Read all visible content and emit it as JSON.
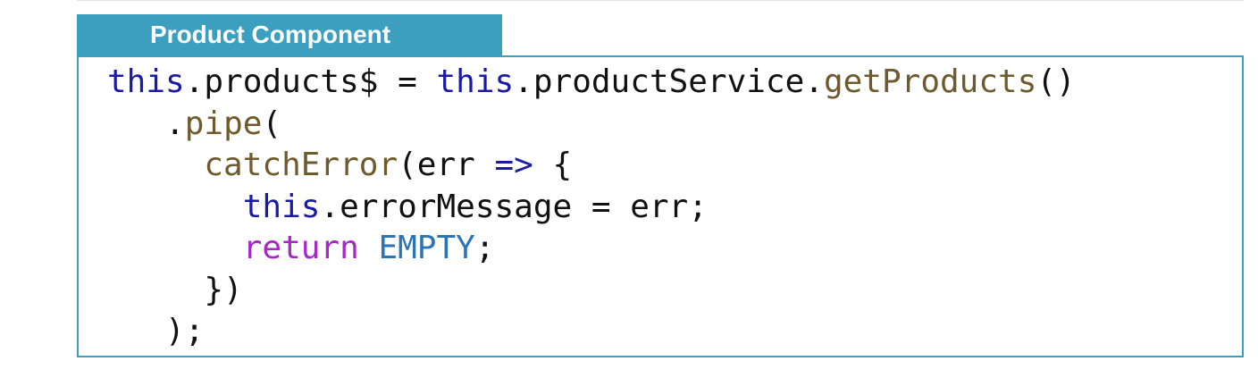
{
  "header": {
    "title": "Product Component"
  },
  "code": {
    "l1_this1": "this",
    "l1_a": ".products$ = ",
    "l1_this2": "this",
    "l1_b": ".productService.",
    "l1_fn": "getProducts",
    "l1_c": "()",
    "l2_indent": "   ",
    "l2_dot": ".",
    "l2_fn": "pipe",
    "l2_paren": "(",
    "l3_indent": "     ",
    "l3_fn": "catchError",
    "l3_a": "(err ",
    "l3_arrow": "=>",
    "l3_b": " {",
    "l4_indent": "       ",
    "l4_this": "this",
    "l4_a": ".errorMessage = err;",
    "l5_indent": "       ",
    "l5_return": "return",
    "l5_sp": " ",
    "l5_const": "EMPTY",
    "l5_semi": ";",
    "l6_indent": "     ",
    "l6_text": "})",
    "l7_indent": "   ",
    "l7_text": ");"
  },
  "colors": {
    "accent": "#3d9fbf",
    "keyword_this": "#1a1aa6",
    "keyword_return": "#a626c8",
    "function": "#6e5a2c",
    "constant": "#2c74b8"
  }
}
